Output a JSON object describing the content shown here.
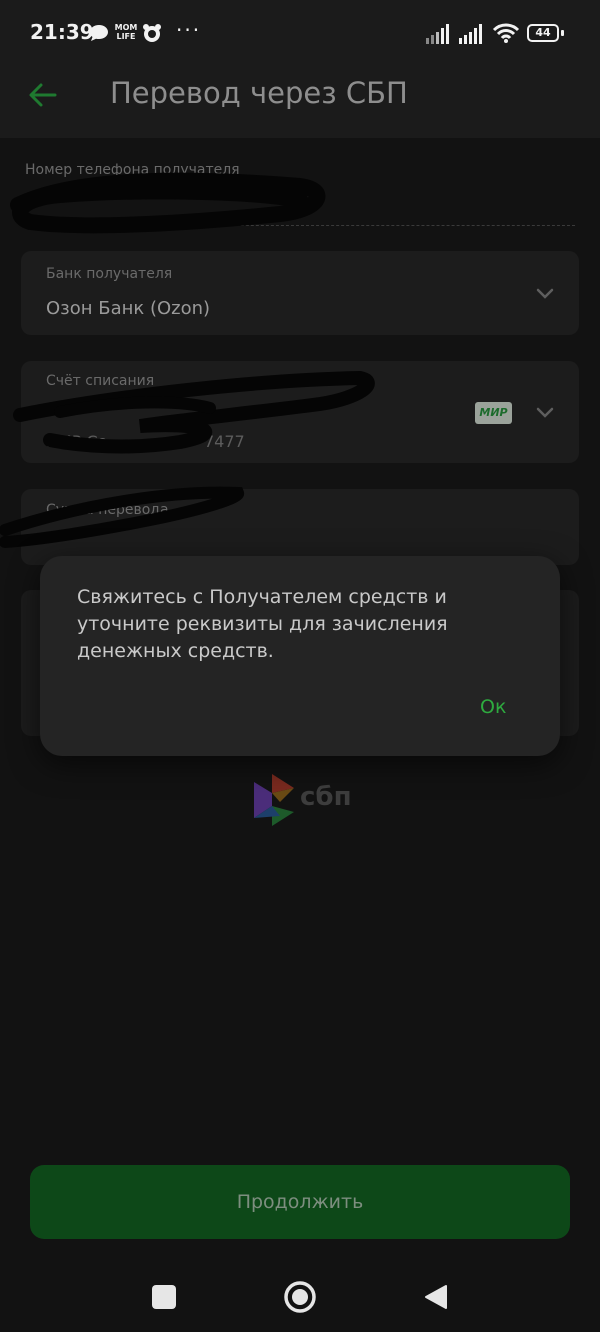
{
  "status_bar": {
    "time": "21:39",
    "app_badge": "MOM LIFE",
    "more": "···",
    "battery": "44"
  },
  "header": {
    "title": "Перевод через СБП",
    "back_icon": "arrow-left-icon"
  },
  "form": {
    "phone_label": "Номер телефона получателя",
    "bank_label": "Банк получателя",
    "bank_value": "Озон Банк (Ozon)",
    "account_label": "Счёт списания",
    "account_line": "МИР Со",
    "account_suffix": "7477",
    "card_brand": "МИР",
    "amount_label": "Сумма перевода"
  },
  "logo": {
    "text": "сбп"
  },
  "dialog": {
    "message": "Свяжитесь с Получателем средств и уточните реквизиты для зачисления денежных средств.",
    "ok_label": "Ок"
  },
  "footer": {
    "continue_label": "Продолжить"
  },
  "colors": {
    "accent": "#2eaa3f",
    "button_bg": "#0d4818",
    "background": "#121212",
    "dialog_bg": "#242424"
  }
}
